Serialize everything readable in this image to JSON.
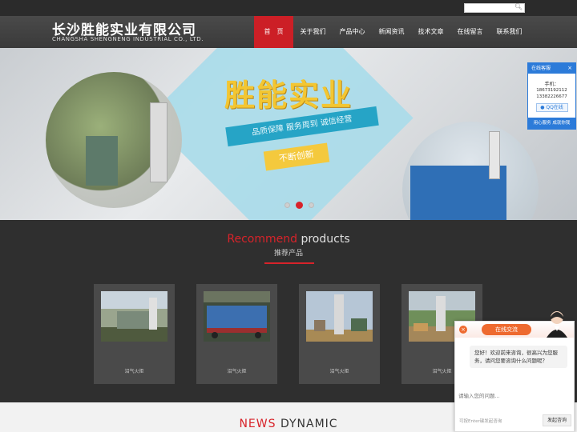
{
  "header": {
    "logo_cn": "长沙胜能实业有限公司",
    "logo_en": "CHANGSHA SHENGNENG INDUSTRIAL CO., LTD."
  },
  "search": {
    "placeholder": ""
  },
  "nav": {
    "items": [
      {
        "label": "首　页",
        "active": true
      },
      {
        "label": "关于我们",
        "active": false
      },
      {
        "label": "产品中心",
        "active": false
      },
      {
        "label": "新闻资讯",
        "active": false
      },
      {
        "label": "技术文章",
        "active": false
      },
      {
        "label": "在线留言",
        "active": false
      },
      {
        "label": "联系我们",
        "active": false
      }
    ]
  },
  "banner": {
    "title": "胜能实业",
    "ribbon": "品质保障 服务周到 诚信经营",
    "ribbon2": "不断创新",
    "slides": 3,
    "active_slide": 2
  },
  "recommend": {
    "title_red": "Recommend",
    "title_rest": " products",
    "subtitle": "推荐产品"
  },
  "products": [
    {
      "name": "沼气火炬"
    },
    {
      "name": "沼气火炬"
    },
    {
      "name": "沼气火炬"
    },
    {
      "name": "沼气火炬"
    }
  ],
  "news": {
    "title_red": "NEWS",
    "title_rest": " DYNAMIC"
  },
  "service": {
    "title": "在线客服",
    "close": "×",
    "phone_label": "手机：",
    "phones": [
      "18673192112",
      "13382226677"
    ],
    "qq": "QQ在线",
    "footer": "用心服务 成就你我"
  },
  "chat": {
    "tab": "在线交流",
    "close": "×",
    "greeting": "您好！欢迎前来咨询，很高兴为您服务，请问您要咨询什么问题呢？",
    "input_placeholder": "请输入您的问题...",
    "hint": "可按Enter键发起咨询",
    "send": "发起咨询"
  },
  "colors": {
    "accent": "#d8232a",
    "service": "#2c7bd9",
    "chat": "#ee6a2f"
  }
}
